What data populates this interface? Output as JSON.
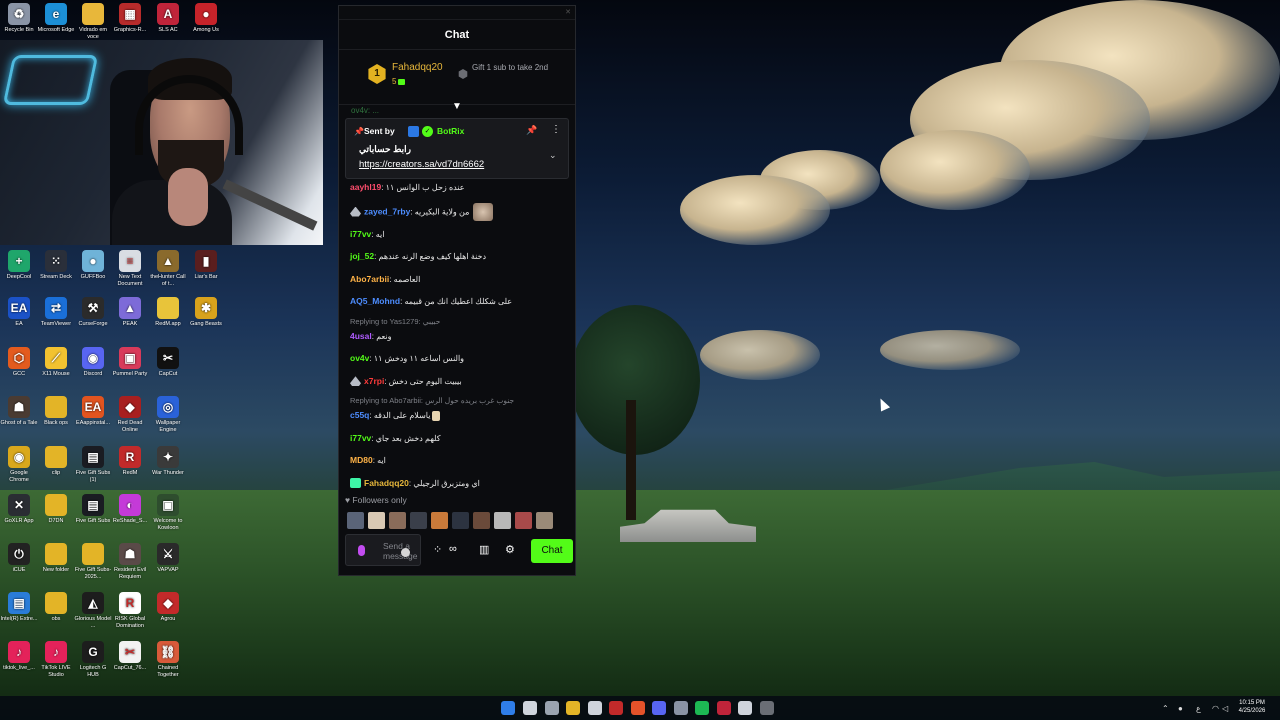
{
  "desktop": {
    "icons": [
      {
        "label": "Recycle Bin",
        "color": "#8a94a6",
        "glyph": "♻"
      },
      {
        "label": "Microsoft Edge",
        "color": "#1c8fd6",
        "glyph": "e"
      },
      {
        "label": "Vidrado em voce",
        "color": "#e8b73a",
        "glyph": ""
      },
      {
        "label": "Graphics-R...",
        "color": "#b72b2b",
        "glyph": "▦"
      },
      {
        "label": "SLS AC",
        "color": "#c0243a",
        "glyph": "A"
      },
      {
        "label": "Among Us",
        "color": "#c6232a",
        "glyph": "●"
      },
      {
        "label": "DeepCool",
        "color": "#1fa66b",
        "glyph": "+"
      },
      {
        "label": "Stream Deck",
        "color": "#2a2f3a",
        "glyph": "⁙"
      },
      {
        "label": "GUFFBoo",
        "color": "#6fb3d8",
        "glyph": "●"
      },
      {
        "label": "New Text Document",
        "color": "#d9dde3",
        "glyph": "≡"
      },
      {
        "label": "theHunter Call of t...",
        "color": "#8a6a2c",
        "glyph": "▲"
      },
      {
        "label": "Liar's Bar",
        "color": "#5a1e1e",
        "glyph": "▮"
      },
      {
        "label": "EA",
        "color": "#1b52c7",
        "glyph": "EA"
      },
      {
        "label": "TeamViewer",
        "color": "#1a6fd8",
        "glyph": "⇄"
      },
      {
        "label": "CurseForge",
        "color": "#2b2b2b",
        "glyph": "⚒"
      },
      {
        "label": "PEAK",
        "color": "#7d6bd8",
        "glyph": "▲"
      },
      {
        "label": "RedM.app",
        "color": "#e8c43a",
        "glyph": ""
      },
      {
        "label": "Gang Beasts",
        "color": "#d8a21c",
        "glyph": "✱"
      },
      {
        "label": "GCC",
        "color": "#e35b1e",
        "glyph": "⬡"
      },
      {
        "label": "X11 Mouse",
        "color": "#f2c230",
        "glyph": "⟋"
      },
      {
        "label": "Discord",
        "color": "#5865f2",
        "glyph": "◉"
      },
      {
        "label": "Pummel Party",
        "color": "#d83a5a",
        "glyph": "▣"
      },
      {
        "label": "CapCut",
        "color": "#111111",
        "glyph": "✂"
      },
      {
        "label": "Ghost of a Tale",
        "color": "#4a3b32",
        "glyph": "☗"
      },
      {
        "label": "Black ops",
        "color": "#e3b427",
        "glyph": ""
      },
      {
        "label": "EAappinstal...",
        "color": "#e2541f",
        "glyph": "EA"
      },
      {
        "label": "Red Dead Online",
        "color": "#a81f1f",
        "glyph": "◆"
      },
      {
        "label": "Wallpaper Engine",
        "color": "#2a62d8",
        "glyph": "◎"
      },
      {
        "label": "Google Chrome",
        "color": "#d9a81c",
        "glyph": "◉"
      },
      {
        "label": "clip",
        "color": "#e3b427",
        "glyph": ""
      },
      {
        "label": "Five Gift Subs (1)",
        "color": "#1a1c22",
        "glyph": "▤"
      },
      {
        "label": "RedM",
        "color": "#c22a2a",
        "glyph": "R"
      },
      {
        "label": "War Thunder",
        "color": "#3a3a3a",
        "glyph": "✦"
      },
      {
        "label": "GoXLR App",
        "color": "#2a2d33",
        "glyph": "✕"
      },
      {
        "label": "D7DN",
        "color": "#e3b427",
        "glyph": ""
      },
      {
        "label": "Five Gift Subs",
        "color": "#1a1c22",
        "glyph": "▤"
      },
      {
        "label": "ReShade_S...",
        "color": "#c43ad8",
        "glyph": "◐"
      },
      {
        "label": "Welcome to Kowloon",
        "color": "#2e4d2e",
        "glyph": "▣"
      },
      {
        "label": "iCUE",
        "color": "#222222",
        "glyph": "⏻"
      },
      {
        "label": "New folder",
        "color": "#e3b427",
        "glyph": ""
      },
      {
        "label": "Five Gift Subs-2025...",
        "color": "#e3b427",
        "glyph": ""
      },
      {
        "label": "Resident Evil Requiem",
        "color": "#5a4a48",
        "glyph": "☗"
      },
      {
        "label": "VAPVAP",
        "color": "#2a2a2a",
        "glyph": "⚔"
      },
      {
        "label": "Intel(R) Extre...",
        "color": "#2a7cd8",
        "glyph": "▤"
      },
      {
        "label": "obs",
        "color": "#e3b427",
        "glyph": ""
      },
      {
        "label": "Glorious Model ...",
        "color": "#1d1d1d",
        "glyph": "◭"
      },
      {
        "label": "RISK Global Domination",
        "color": "#ffffff",
        "glyph": "R"
      },
      {
        "label": "Agrou",
        "color": "#c22a2a",
        "glyph": "◆"
      },
      {
        "label": "tiktok_live_...",
        "color": "#e4225a",
        "glyph": "♪"
      },
      {
        "label": "TikTok LIVE Studio",
        "color": "#e4225a",
        "glyph": "♪"
      },
      {
        "label": "Logitech G HUB",
        "color": "#1d1d1d",
        "glyph": "G"
      },
      {
        "label": "CapCut_76...",
        "color": "#f2f2f2",
        "glyph": "✂"
      },
      {
        "label": "Chained Together",
        "color": "#d85a3a",
        "glyph": "⛓"
      }
    ]
  },
  "chat": {
    "title": "Chat",
    "leader": {
      "rank": "1",
      "name": "Fahadqq20",
      "count": "5",
      "take_text": "Gift 1 sub to take 2nd"
    },
    "partial_top_message": "ov4v: ...",
    "pinned": {
      "sent_by_label": "Sent by",
      "bot_name": "BotRix",
      "text": "رابط حساباتي",
      "link": "https://creators.sa/vd7dn6662"
    },
    "messages": [
      {
        "user": "aayhl19",
        "color": "#ff4d6d",
        "text": "عنده زحل ب الوانس ١١"
      },
      {
        "user": "zayed_7rby",
        "color": "#4d8dff",
        "text": "من ولاية البكيريه",
        "badge": "drop",
        "emote": true
      },
      {
        "user": "i77vv",
        "color": "#53fc18",
        "text": "ايه"
      },
      {
        "user": "joj_52",
        "color": "#53fc18",
        "text": "دخنة اهلها كيف وضع الرنه عندهم"
      },
      {
        "user": "Abo7arbii",
        "color": "#ffb347",
        "text": "العاصمه"
      },
      {
        "user": "AQ5_Mohnd",
        "color": "#4d8dff",
        "text": "على شكلك اعطيك انك من قبيمه"
      },
      {
        "user": "4usal",
        "color": "#b05cff",
        "text": "ونعم",
        "reply": "Replying to Yas1279: حبيبي"
      },
      {
        "user": "ov4v",
        "color": "#53fc18",
        "text": "والنس اساعه ١١ ودخش ١١"
      },
      {
        "user": "x7rpi",
        "color": "#ff3b3b",
        "text": "بيبيت اليوم حتى دخش",
        "badge": "drop"
      },
      {
        "user": "c55q",
        "color": "#4d8dff",
        "text": "ياسلام على الدقه",
        "reply": "Replying to Abo7arbii: جنوب غرب بريده حول الرس",
        "tiny": true
      },
      {
        "user": "i77vv",
        "color": "#53fc18",
        "text": "كلهم دخش بعد جاي"
      },
      {
        "user": "MD80",
        "color": "#ffb347",
        "text": "ايه"
      },
      {
        "user": "Fahadqq20",
        "color": "#e7b73b",
        "text": "اي ومتزبرق الرجيلي",
        "badge": "gifter"
      }
    ],
    "followers_only": "Followers only",
    "avatar_colors": [
      "#5a6478",
      "#d9c9b4",
      "#8a6c5a",
      "#3a3f4a",
      "#c97a3a",
      "#2c3340",
      "#6a4a3a",
      "#b8b8b8",
      "#a84a4a",
      "#9a8a78",
      "#3a3a3a"
    ],
    "input_placeholder": "Send a message",
    "send_label": "Chat"
  },
  "taskbar": {
    "time": "10:15 PM",
    "date": "4/25/2026",
    "pinned_app_colors": [
      "#2f7de8",
      "#cfd4dc",
      "#9aa3b0",
      "#e3b427",
      "#cfd4dc",
      "#c22a2a",
      "#e3522a",
      "#5865f2",
      "#8a94a6",
      "#1db954",
      "#c0243a",
      "#cfd4dc",
      "#6a6e75"
    ]
  }
}
